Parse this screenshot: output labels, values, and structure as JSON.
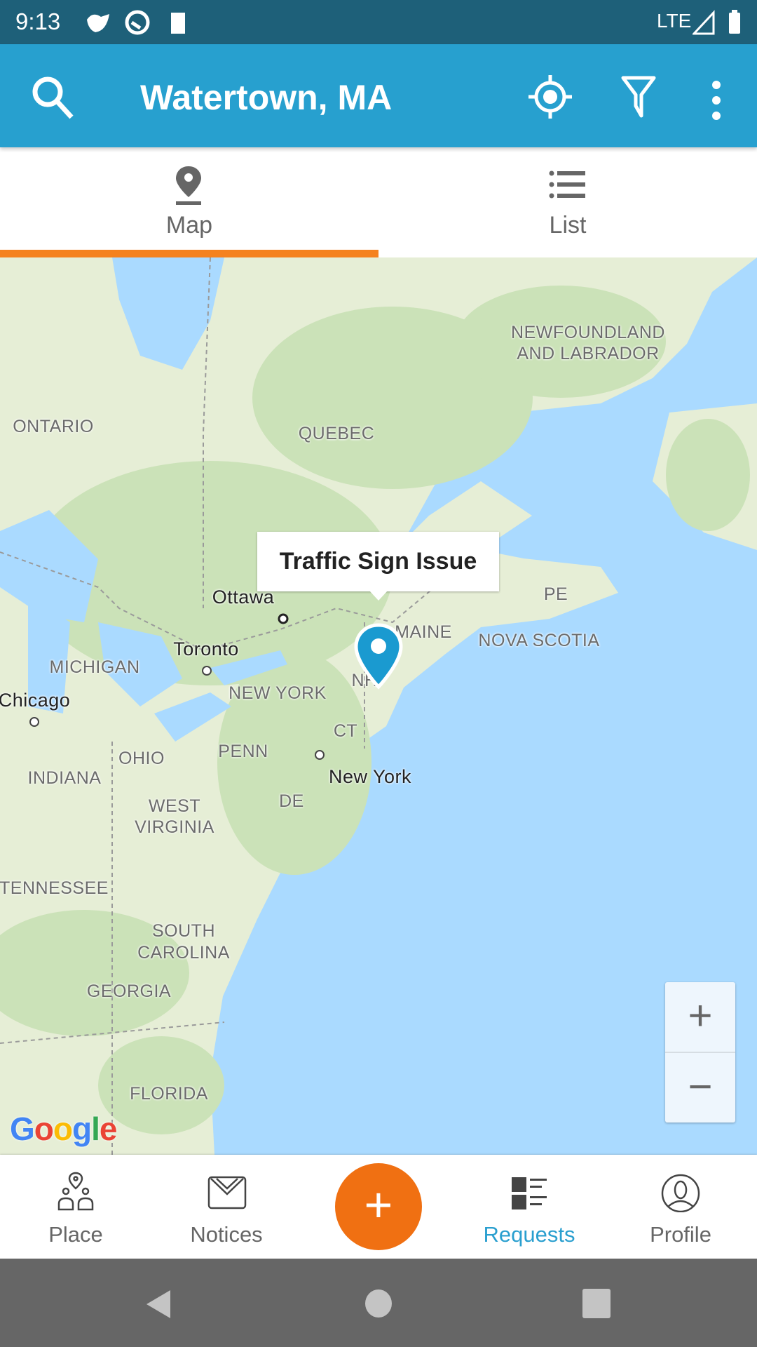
{
  "status_bar": {
    "time": "9:13",
    "network": "LTE"
  },
  "app_bar": {
    "title": "Watertown, MA",
    "icons": [
      "search-icon",
      "my-location-icon",
      "filter-icon",
      "more-vert-icon"
    ]
  },
  "tabs": [
    {
      "label": "Map",
      "icon": "map-pin-icon",
      "selected": true
    },
    {
      "label": "List",
      "icon": "list-icon",
      "selected": false
    }
  ],
  "map": {
    "callout": "Traffic Sign Issue",
    "labels": [
      "NEWFOUNDLAND",
      "AND LABRADOR",
      "ONTARIO",
      "QUEBEC",
      "Ottawa",
      "Toronto",
      "MICHIGAN",
      "Chicago",
      "NEW YORK",
      "MAINE",
      "NOVA SCOTIA",
      "PE",
      "NH",
      "CT",
      "New York",
      "PENN",
      "OHIO",
      "INDIANA",
      "WEST",
      "VIRGINIA",
      "DE",
      "TENNESSEE",
      "SOUTH",
      "CAROLINA",
      "GEORGIA",
      "FLORIDA"
    ],
    "logo": "Google",
    "zoom_in": "+",
    "zoom_out": "−"
  },
  "bottom_nav": [
    {
      "label": "Place"
    },
    {
      "label": "Notices"
    },
    {
      "label": "+"
    },
    {
      "label": "Requests",
      "active": true
    },
    {
      "label": "Profile"
    }
  ],
  "colors": {
    "status": "#1e6079",
    "app_bar": "#27a0cf",
    "accent": "#f07012",
    "tab_indicator": "#f5821f",
    "active": "#2a9fcf",
    "pin": "#1a9ad0"
  }
}
